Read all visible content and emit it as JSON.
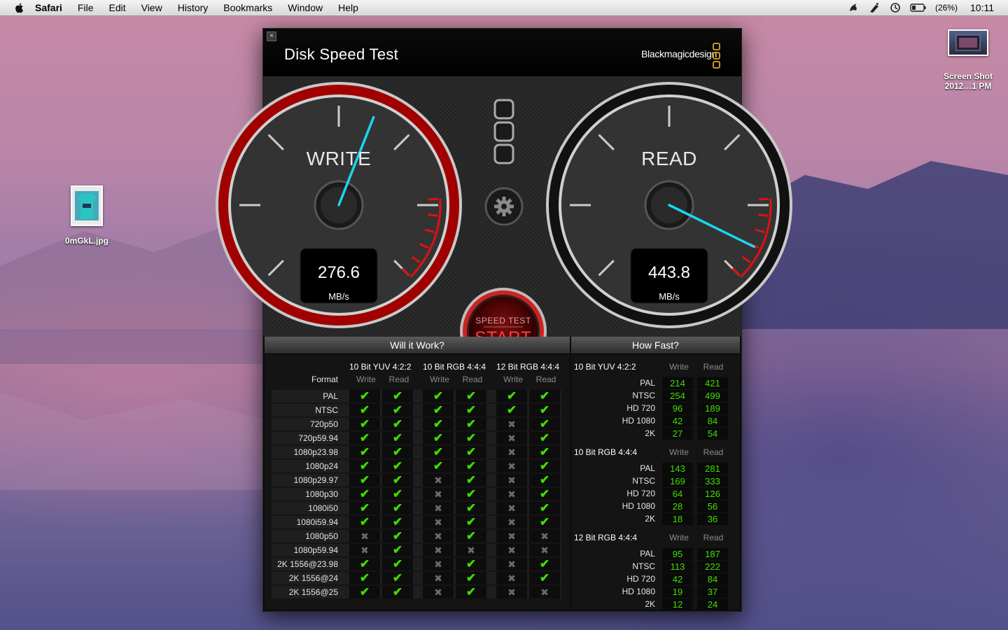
{
  "menubar": {
    "app_name": "Safari",
    "menus": [
      "File",
      "Edit",
      "View",
      "History",
      "Bookmarks",
      "Window",
      "Help"
    ],
    "battery": "(26%)",
    "clock": "10:11"
  },
  "desktop": {
    "screenshot_label_1": "Screen Shot",
    "screenshot_label_2": "2012…1 PM",
    "image_file_label": "0mGkL.jpg"
  },
  "window": {
    "title": "Disk Speed Test",
    "brand": "Blackmagicdesign"
  },
  "gauges": {
    "write": {
      "title": "WRITE",
      "value": "276.6",
      "unit": "MB/s",
      "needle_fraction": 0.58
    },
    "read": {
      "title": "READ",
      "value": "443.8",
      "unit": "MB/s",
      "needle_fraction": 0.93
    }
  },
  "start_button": {
    "top_label": "SPEED TEST",
    "label": "START"
  },
  "will_it_work": {
    "title": "Will it Work?",
    "groups": [
      "10 Bit YUV 4:2:2",
      "10 Bit RGB 4:4:4",
      "12 Bit RGB 4:4:4"
    ],
    "format_header": "Format",
    "write_label": "Write",
    "read_label": "Read",
    "rows": [
      {
        "format": "PAL",
        "marks": [
          1,
          1,
          1,
          1,
          1,
          1
        ]
      },
      {
        "format": "NTSC",
        "marks": [
          1,
          1,
          1,
          1,
          1,
          1
        ]
      },
      {
        "format": "720p50",
        "marks": [
          1,
          1,
          1,
          1,
          0,
          1
        ]
      },
      {
        "format": "720p59.94",
        "marks": [
          1,
          1,
          1,
          1,
          0,
          1
        ]
      },
      {
        "format": "1080p23.98",
        "marks": [
          1,
          1,
          1,
          1,
          0,
          1
        ]
      },
      {
        "format": "1080p24",
        "marks": [
          1,
          1,
          1,
          1,
          0,
          1
        ]
      },
      {
        "format": "1080p29.97",
        "marks": [
          1,
          1,
          0,
          1,
          0,
          1
        ]
      },
      {
        "format": "1080p30",
        "marks": [
          1,
          1,
          0,
          1,
          0,
          1
        ]
      },
      {
        "format": "1080i50",
        "marks": [
          1,
          1,
          0,
          1,
          0,
          1
        ]
      },
      {
        "format": "1080i59.94",
        "marks": [
          1,
          1,
          0,
          1,
          0,
          1
        ]
      },
      {
        "format": "1080p50",
        "marks": [
          0,
          1,
          0,
          1,
          0,
          0
        ]
      },
      {
        "format": "1080p59.94",
        "marks": [
          0,
          1,
          0,
          0,
          0,
          0
        ]
      },
      {
        "format": "2K 1556@23.98",
        "marks": [
          1,
          1,
          0,
          1,
          0,
          1
        ]
      },
      {
        "format": "2K 1556@24",
        "marks": [
          1,
          1,
          0,
          1,
          0,
          1
        ]
      },
      {
        "format": "2K 1556@25",
        "marks": [
          1,
          1,
          0,
          1,
          0,
          0
        ]
      }
    ]
  },
  "how_fast": {
    "title": "How Fast?",
    "write_label": "Write",
    "read_label": "Read",
    "sections": [
      {
        "name": "10 Bit YUV 4:2:2",
        "rows": [
          {
            "format": "PAL",
            "write": "214",
            "read": "421"
          },
          {
            "format": "NTSC",
            "write": "254",
            "read": "499"
          },
          {
            "format": "HD 720",
            "write": "96",
            "read": "189"
          },
          {
            "format": "HD 1080",
            "write": "42",
            "read": "84"
          },
          {
            "format": "2K",
            "write": "27",
            "read": "54"
          }
        ]
      },
      {
        "name": "10 Bit RGB 4:4:4",
        "rows": [
          {
            "format": "PAL",
            "write": "143",
            "read": "281"
          },
          {
            "format": "NTSC",
            "write": "169",
            "read": "333"
          },
          {
            "format": "HD 720",
            "write": "64",
            "read": "126"
          },
          {
            "format": "HD 1080",
            "write": "28",
            "read": "56"
          },
          {
            "format": "2K",
            "write": "18",
            "read": "36"
          }
        ]
      },
      {
        "name": "12 Bit RGB 4:4:4",
        "rows": [
          {
            "format": "PAL",
            "write": "95",
            "read": "187"
          },
          {
            "format": "NTSC",
            "write": "113",
            "read": "222"
          },
          {
            "format": "HD 720",
            "write": "42",
            "read": "84"
          },
          {
            "format": "HD 1080",
            "write": "19",
            "read": "37"
          },
          {
            "format": "2K",
            "write": "12",
            "read": "24"
          }
        ]
      }
    ]
  },
  "icons": {
    "apple": "apple-icon",
    "settings": "gear-icon",
    "close": "close-icon"
  }
}
